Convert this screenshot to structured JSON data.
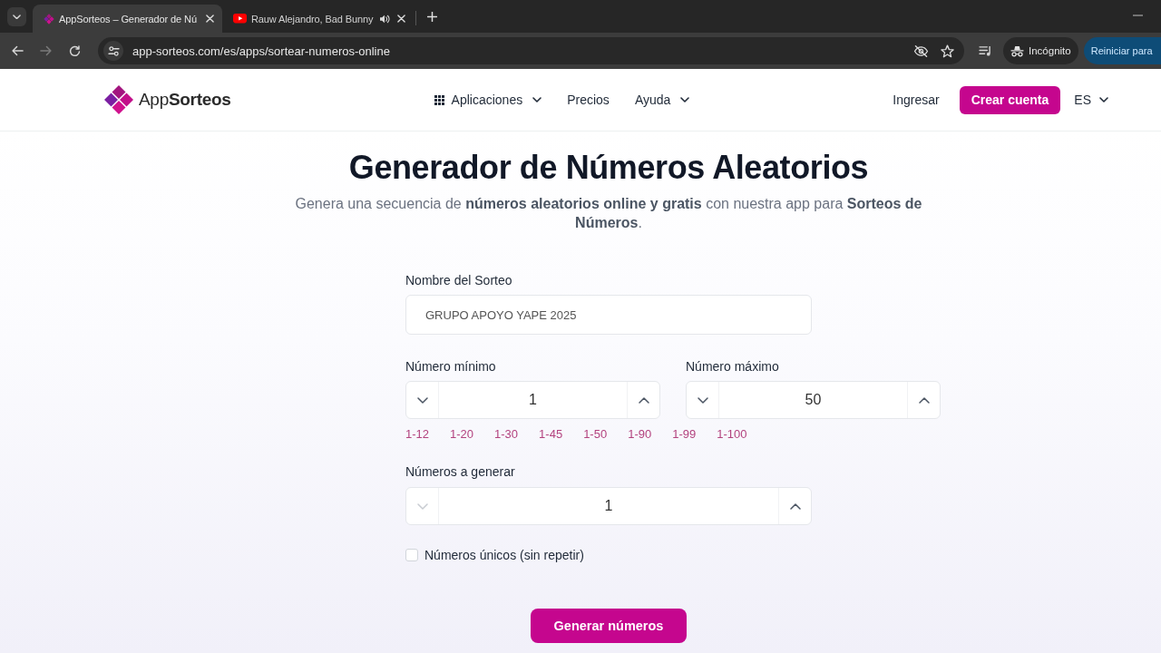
{
  "browser": {
    "tabs": [
      {
        "title": "AppSorteos – Generador de Nú",
        "selected": true,
        "kind": "app",
        "audio": false
      },
      {
        "title": "Rauw Alejandro, Bad Bunny",
        "selected": false,
        "kind": "video",
        "audio": true
      }
    ],
    "forward_disabled": true,
    "url": "app-sorteos.com/es/apps/sortear-numeros-online",
    "profile": "Incógnito",
    "update_button": "Reiniciar para"
  },
  "header": {
    "logo": "App**Sorteos**",
    "nav": [
      {
        "label": "Aplicaciones",
        "kind": "apps_menu"
      },
      {
        "label": "Precios",
        "kind": "link"
      },
      {
        "label": "Ayuda",
        "kind": "menu"
      }
    ],
    "login": "Ingresar",
    "signup": "Crear cuenta",
    "language": "ES"
  },
  "hero": {
    "title": "Generador de Números Aleatorios",
    "subtitle": "Genera una secuencia de **números aleatorios online y gratis** con nuestra app para **Sorteos de Números**."
  },
  "form": {
    "name_field": {
      "label": "Nombre del Sorteo",
      "value": "GRUPO APOYO YAPE 2025"
    },
    "range_fields": [
      {
        "label": "Número mínimo",
        "value": "1",
        "decrement_disabled": false
      },
      {
        "label": "Número máximo",
        "value": "50",
        "decrement_disabled": false
      }
    ],
    "presets": [
      "1-12",
      "1-20",
      "1-30",
      "1-45",
      "1-50",
      "1-90",
      "1-99",
      "1-100"
    ],
    "count_field": {
      "label": "Números a generar",
      "value": "1",
      "decrement_disabled": true
    },
    "unique": {
      "label": "Números únicos (sin repetir)",
      "checked": false
    },
    "submit": "Generar números"
  }
}
